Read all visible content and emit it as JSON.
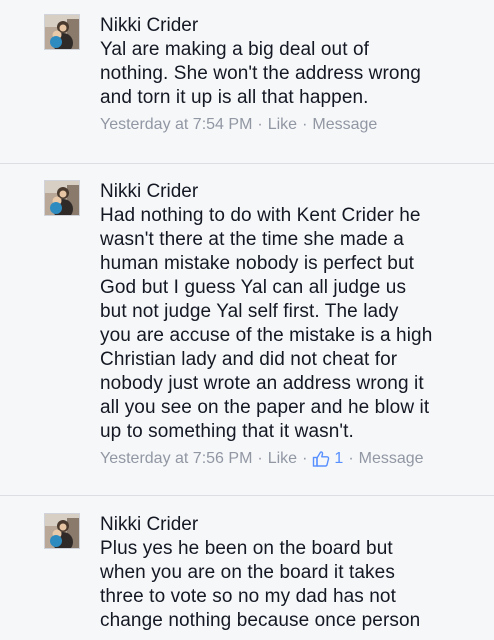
{
  "colors": {
    "background": "#f6f7f9",
    "text": "#141823",
    "meta": "#9197a3",
    "divider": "#dcdee3",
    "like_accent": "#5890ff"
  },
  "comments": [
    {
      "author": "Nikki Crider",
      "text": "Yal are making a big deal out of\nnothing. She won't the address wrong\nand torn it up is all that happen.",
      "time": "Yesterday at 7:54 PM",
      "separator": "·",
      "like_label": "Like",
      "message_label": "Message"
    },
    {
      "author": "Nikki Crider",
      "text": "Had nothing to do with Kent Crider he\nwasn't there at the time she made a\nhuman mistake nobody is perfect but\nGod but I guess Yal can all judge us\nbut not judge Yal self first. The lady\nyou are accuse of the mistake is a high\nChristian lady and did not cheat for\nnobody just wrote an address wrong it\nall you see on the paper and he blow it\nup to something that it wasn't.",
      "time": "Yesterday at 7:56 PM",
      "separator": "·",
      "like_label": "Like",
      "like_count": "1",
      "like_icon": "thumbs-up-icon",
      "message_label": "Message"
    },
    {
      "author": "Nikki Crider",
      "text": "Plus yes he been on the board but\nwhen you are on the board it takes\nthree to vote so no my dad has not\nchange nothing because once person"
    }
  ]
}
